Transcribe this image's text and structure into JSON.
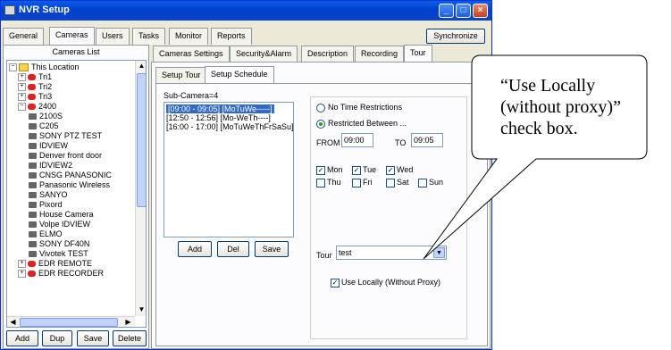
{
  "window": {
    "title": "NVR Setup"
  },
  "main_tabs": [
    {
      "label": "General"
    },
    {
      "label": "Cameras"
    },
    {
      "label": "Users"
    },
    {
      "label": "Tasks"
    },
    {
      "label": "Monitor"
    },
    {
      "label": "Reports"
    }
  ],
  "synchronize_label": "Synchronize",
  "cameras_list": {
    "title": "Cameras List",
    "items": [
      {
        "label": "This Location"
      },
      {
        "label": "Tri1"
      },
      {
        "label": "Tri2"
      },
      {
        "label": "Tri3"
      },
      {
        "label": "2400"
      },
      {
        "label": "2100S"
      },
      {
        "label": "C205"
      },
      {
        "label": "SONY PTZ TEST"
      },
      {
        "label": "IDVIEW"
      },
      {
        "label": "Denver front door"
      },
      {
        "label": "IDVIEW2"
      },
      {
        "label": "CNSG PANASONIC"
      },
      {
        "label": "Panasonic Wireless"
      },
      {
        "label": "SANYO"
      },
      {
        "label": "Pixord"
      },
      {
        "label": "House Camera"
      },
      {
        "label": "Volpe IDVIEW"
      },
      {
        "label": "ELMO"
      },
      {
        "label": "SONY DF40N"
      },
      {
        "label": "Vivotek TEST"
      },
      {
        "label": "EDR REMOTE"
      },
      {
        "label": "EDR RECORDER"
      }
    ]
  },
  "bottom_buttons": {
    "add": "Add",
    "dup": "Dup",
    "save": "Save",
    "delete": "Delete"
  },
  "settings_tabs": [
    {
      "label": "Cameras Settings"
    },
    {
      "label": "Security&Alarm"
    },
    {
      "label": "Description"
    },
    {
      "label": "Recording"
    },
    {
      "label": "Tour"
    }
  ],
  "sub_tabs": [
    {
      "label": "Setup Tour"
    },
    {
      "label": "Setup Schedule"
    }
  ],
  "schedule": {
    "sub_camera_label": "Sub-Camera=4",
    "entries": [
      {
        "text": "[09:00 - 09:05] [MoTuWe-----]"
      },
      {
        "text": "[12:50 - 12:56] [Mo-WeTh----]"
      },
      {
        "text": "[16:00 - 17:00] [MoTuWeThFrSaSu]"
      }
    ],
    "add": "Add",
    "del": "Del",
    "save": "Save"
  },
  "restrictions": {
    "no_time": "No Time Restrictions",
    "restricted": "Restricted Between ...",
    "from_label": "FROM",
    "from_value": "09:00",
    "to_label": "TO",
    "to_value": "09:05"
  },
  "days": {
    "mon": "Mon",
    "tue": "Tue",
    "wed": "Wed",
    "thu": "Thu",
    "fri": "Fri",
    "sat": "Sat",
    "sun": "Sun"
  },
  "tour": {
    "label": "Tour",
    "value": "test"
  },
  "use_locally_label": "Use Locally (Without Proxy)",
  "callout": {
    "line1": "“Use Locally",
    "line2": "(without proxy)”",
    "line3": "check box."
  },
  "colors": {
    "title_bar": "#0a5fe8",
    "selection": "#316ac5",
    "window_bg": "#ece9d8"
  }
}
